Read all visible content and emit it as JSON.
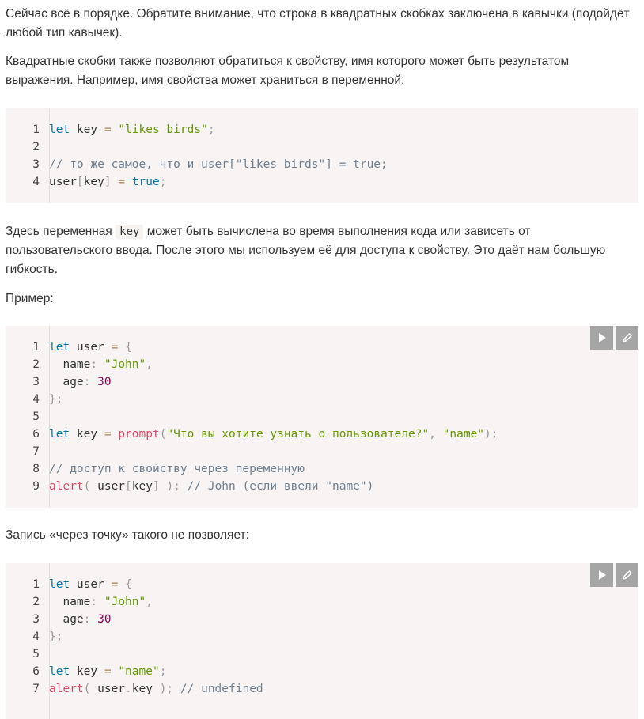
{
  "intro": {
    "p1": "Сейчас всё в порядке. Обратите внимание, что строка в квадратных скобках заключена в кавычки (подойдёт любой тип кавычек).",
    "p2": "Квадратные скобки также позволяют обратиться к свойству, имя которого может быть результатом выражения. Например, имя свойства может храниться в переменной:"
  },
  "code1": {
    "line_numbers": [
      "1",
      "2",
      "3",
      "4"
    ],
    "lines": [
      [
        {
          "t": "let",
          "c": "kw"
        },
        {
          "t": " key ",
          "c": ""
        },
        {
          "t": "=",
          "c": "op"
        },
        {
          "t": " ",
          "c": ""
        },
        {
          "t": "\"likes birds\"",
          "c": "str"
        },
        {
          "t": ";",
          "c": "punc"
        }
      ],
      [],
      [
        {
          "t": "// то же самое, что и user[\"likes birds\"] = true;",
          "c": "cm"
        }
      ],
      [
        {
          "t": "user",
          "c": ""
        },
        {
          "t": "[",
          "c": "punc"
        },
        {
          "t": "key",
          "c": ""
        },
        {
          "t": "]",
          "c": "punc"
        },
        {
          "t": " ",
          "c": ""
        },
        {
          "t": "=",
          "c": "op"
        },
        {
          "t": " ",
          "c": ""
        },
        {
          "t": "true",
          "c": "kw"
        },
        {
          "t": ";",
          "c": "punc"
        }
      ]
    ]
  },
  "mid": {
    "p3_before": "Здесь переменная ",
    "p3_code": "key",
    "p3_after": " может быть вычислена во время выполнения кода или зависеть от пользовательского ввода. После этого мы используем её для доступа к свойству. Это даёт нам большую гибкость.",
    "p4": "Пример:"
  },
  "code2": {
    "line_numbers": [
      "1",
      "2",
      "3",
      "4",
      "5",
      "6",
      "7",
      "8",
      "9"
    ],
    "lines": [
      [
        {
          "t": "let",
          "c": "kw"
        },
        {
          "t": " user ",
          "c": ""
        },
        {
          "t": "=",
          "c": "op"
        },
        {
          "t": " ",
          "c": ""
        },
        {
          "t": "{",
          "c": "punc"
        }
      ],
      [
        {
          "t": "  name",
          "c": ""
        },
        {
          "t": ":",
          "c": "punc"
        },
        {
          "t": " ",
          "c": ""
        },
        {
          "t": "\"John\"",
          "c": "str"
        },
        {
          "t": ",",
          "c": "punc"
        }
      ],
      [
        {
          "t": "  age",
          "c": ""
        },
        {
          "t": ":",
          "c": "punc"
        },
        {
          "t": " ",
          "c": ""
        },
        {
          "t": "30",
          "c": "num"
        }
      ],
      [
        {
          "t": "}",
          "c": "punc"
        },
        {
          "t": ";",
          "c": "punc"
        }
      ],
      [],
      [
        {
          "t": "let",
          "c": "kw"
        },
        {
          "t": " key ",
          "c": ""
        },
        {
          "t": "=",
          "c": "op"
        },
        {
          "t": " ",
          "c": ""
        },
        {
          "t": "prompt",
          "c": "fn"
        },
        {
          "t": "(",
          "c": "punc"
        },
        {
          "t": "\"Что вы хотите узнать о пользователе?\"",
          "c": "str"
        },
        {
          "t": ",",
          "c": "punc"
        },
        {
          "t": " ",
          "c": ""
        },
        {
          "t": "\"name\"",
          "c": "str"
        },
        {
          "t": ");",
          "c": "punc"
        }
      ],
      [],
      [
        {
          "t": "// доступ к свойству через переменную",
          "c": "cm"
        }
      ],
      [
        {
          "t": "alert",
          "c": "fn"
        },
        {
          "t": "(",
          "c": "punc"
        },
        {
          "t": " user",
          "c": ""
        },
        {
          "t": "[",
          "c": "punc"
        },
        {
          "t": "key",
          "c": ""
        },
        {
          "t": "]",
          "c": "punc"
        },
        {
          "t": " ",
          "c": ""
        },
        {
          "t": ");",
          "c": "punc"
        },
        {
          "t": " ",
          "c": ""
        },
        {
          "t": "// John (если ввели \"name\")",
          "c": "cm"
        }
      ]
    ],
    "toolbar": {
      "run_icon": "play-icon",
      "edit_icon": "pencil-icon"
    }
  },
  "mid2": {
    "p5": "Запись «через точку» такого не позволяет:"
  },
  "code3": {
    "line_numbers": [
      "1",
      "2",
      "3",
      "4",
      "5",
      "6",
      "7"
    ],
    "lines": [
      [
        {
          "t": "let",
          "c": "kw"
        },
        {
          "t": " user ",
          "c": ""
        },
        {
          "t": "=",
          "c": "op"
        },
        {
          "t": " ",
          "c": ""
        },
        {
          "t": "{",
          "c": "punc"
        }
      ],
      [
        {
          "t": "  name",
          "c": ""
        },
        {
          "t": ":",
          "c": "punc"
        },
        {
          "t": " ",
          "c": ""
        },
        {
          "t": "\"John\"",
          "c": "str"
        },
        {
          "t": ",",
          "c": "punc"
        }
      ],
      [
        {
          "t": "  age",
          "c": ""
        },
        {
          "t": ":",
          "c": "punc"
        },
        {
          "t": " ",
          "c": ""
        },
        {
          "t": "30",
          "c": "num"
        }
      ],
      [
        {
          "t": "}",
          "c": "punc"
        },
        {
          "t": ";",
          "c": "punc"
        }
      ],
      [],
      [
        {
          "t": "let",
          "c": "kw"
        },
        {
          "t": " key ",
          "c": ""
        },
        {
          "t": "=",
          "c": "op"
        },
        {
          "t": " ",
          "c": ""
        },
        {
          "t": "\"name\"",
          "c": "str"
        },
        {
          "t": ";",
          "c": "punc"
        }
      ],
      [
        {
          "t": "alert",
          "c": "fn"
        },
        {
          "t": "(",
          "c": "punc"
        },
        {
          "t": " user",
          "c": ""
        },
        {
          "t": ".",
          "c": "punc"
        },
        {
          "t": "key ",
          "c": ""
        },
        {
          "t": ");",
          "c": "punc"
        },
        {
          "t": " ",
          "c": ""
        },
        {
          "t": "// undefined",
          "c": "cm"
        }
      ]
    ],
    "toolbar": {
      "run_icon": "play-icon",
      "edit_icon": "pencil-icon"
    }
  },
  "colors": {
    "code_background": "#f7f4f3",
    "keyword": "#0077aa",
    "string": "#669900",
    "number": "#990055",
    "function": "#dd4a68",
    "comment": "#708090",
    "toolbar_button": "#a5a5a5"
  }
}
